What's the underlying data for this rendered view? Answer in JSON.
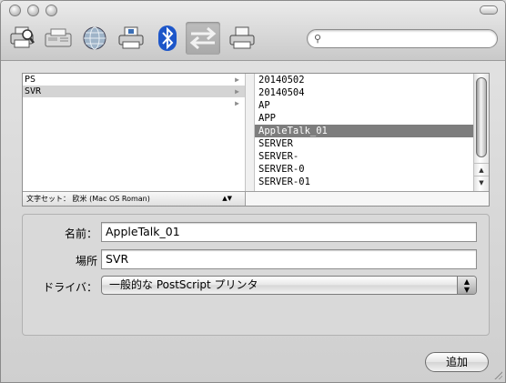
{
  "window": {
    "title": ""
  },
  "toolbar": {
    "icons": [
      {
        "name": "default-browser-icon"
      },
      {
        "name": "fax-icon"
      },
      {
        "name": "ip-printer-icon"
      },
      {
        "name": "windows-printer-icon"
      },
      {
        "name": "bluetooth-icon"
      },
      {
        "name": "appletalk-icon",
        "selected": true
      },
      {
        "name": "more-printers-icon"
      }
    ],
    "search_value": "",
    "search_placeholder": ""
  },
  "browser": {
    "column1": [
      {
        "label": "PS",
        "has_arrow": true,
        "selected": false
      },
      {
        "label": "SVR",
        "has_arrow": true,
        "selected": true
      },
      {
        "label": "",
        "has_arrow": true,
        "selected": false
      }
    ],
    "column2": [
      {
        "label": "20140502",
        "selected": false
      },
      {
        "label": "20140504",
        "selected": false
      },
      {
        "label": "AP",
        "selected": false
      },
      {
        "label": "APP",
        "selected": false
      },
      {
        "label": "AppleTalk_01",
        "selected": true
      },
      {
        "label": "SERVER",
        "selected": false
      },
      {
        "label": "SERVER-",
        "selected": false
      },
      {
        "label": "SERVER-0",
        "selected": false
      },
      {
        "label": "SERVER-01",
        "selected": false
      }
    ],
    "encoding": "文字セット： 欧米 (Mac OS Roman)"
  },
  "form": {
    "name_label": "名前：",
    "name_value": "AppleTalk_01",
    "location_label": "場所",
    "location_value": "SVR",
    "driver_label": "ドライバ：",
    "driver_value": "一般的な PostScript プリンタ"
  },
  "footer": {
    "add_label": "追加"
  },
  "colors": {
    "selection_dark": "#7d7d7d",
    "selection_light": "#d4d4d4",
    "chrome": "#d6d6d6"
  }
}
